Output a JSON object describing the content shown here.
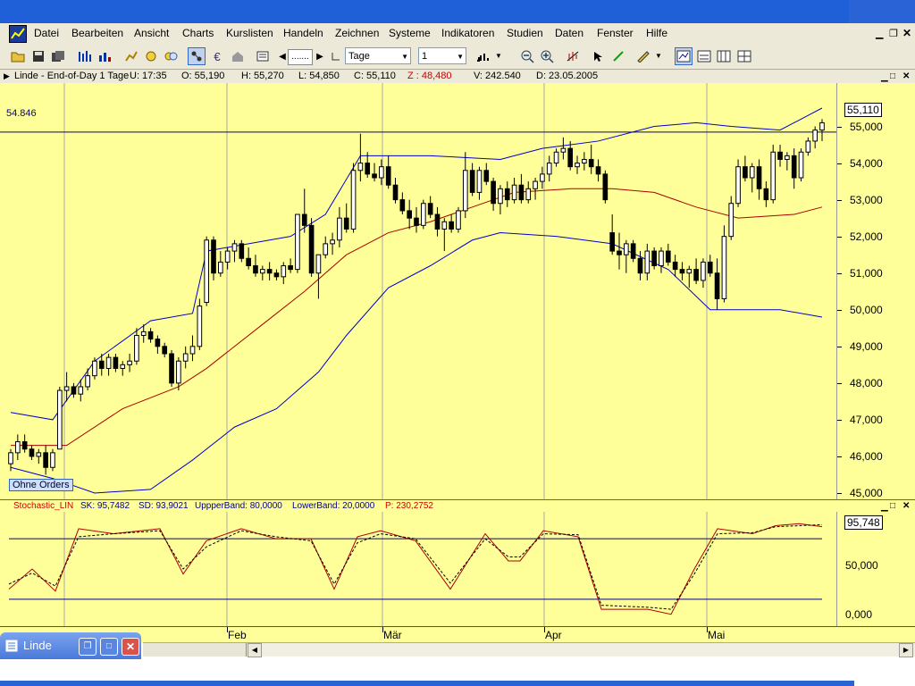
{
  "menu": {
    "items": [
      {
        "name": "datei",
        "label": "Datei"
      },
      {
        "name": "bearbeiten",
        "label": "Bearbeiten"
      },
      {
        "name": "ansicht",
        "label": "Ansicht"
      },
      {
        "name": "charts",
        "label": "Charts"
      },
      {
        "name": "kurslisten",
        "label": "Kurslisten"
      },
      {
        "name": "handeln",
        "label": "Handeln"
      },
      {
        "name": "zeichnen",
        "label": "Zeichnen"
      },
      {
        "name": "systeme",
        "label": "Systeme"
      },
      {
        "name": "indikatoren",
        "label": "Indikatoren"
      },
      {
        "name": "studien",
        "label": "Studien"
      },
      {
        "name": "daten",
        "label": "Daten"
      },
      {
        "name": "fenster",
        "label": "Fenster"
      },
      {
        "name": "hilfe",
        "label": "Hilfe"
      }
    ]
  },
  "toolbar": {
    "period_value": "Tage",
    "interval_value": "1"
  },
  "info": {
    "symbol": "Linde - End-of-Day 1 Tage",
    "u": "U: 17:35",
    "o": "O: 55,190",
    "h": "H: 55,270",
    "l": "L: 54,850",
    "c": "C: 55,110",
    "z": "Z : 48,480",
    "v": "V: 242.540",
    "d": "D: 23.05.2005"
  },
  "price_chart": {
    "line_label": "54.846",
    "last_price": "55,110",
    "orders_label": "Ohne Orders",
    "axis_ticks": [
      "55,000",
      "54,000",
      "53,000",
      "52,000",
      "51,000",
      "50,000",
      "49,000",
      "48,000",
      "47,000",
      "46,000",
      "45,000"
    ]
  },
  "stoch": {
    "title": "Stochastic_LIN",
    "sk": "SK: 95,7482",
    "sd": "SD: 93,9021",
    "upper": "UppperBand: 80,0000",
    "lower": "LowerBand: 20,0000",
    "p": "P: 230,2752",
    "last_value": "95,748",
    "axis_ticks": [
      "50,000",
      "0,000"
    ]
  },
  "dates": [
    "Feb",
    "Mär",
    "Apr",
    "Mai"
  ],
  "taskbar": {
    "window_label": "Linde"
  },
  "colors": {
    "chart_bg": "#ffff99",
    "bollinger": "#0000cc",
    "ma": "#aa0000",
    "candle_down": "#000000",
    "candle_up": "#ffffff"
  },
  "chart_data": {
    "type": "candlestick",
    "title": "Linde - End-of-Day 1 Tage",
    "ylim": [
      45.0,
      55.5
    ],
    "x_labels": [
      "Feb",
      "Mär",
      "Apr",
      "Mai"
    ],
    "candles": [
      [
        45.8,
        46.2,
        45.6,
        46.1
      ],
      [
        46.1,
        46.6,
        45.9,
        46.4
      ],
      [
        46.4,
        46.6,
        46.1,
        46.2
      ],
      [
        46.2,
        46.3,
        45.9,
        46.0
      ],
      [
        46.0,
        46.2,
        45.8,
        46.1
      ],
      [
        46.1,
        46.3,
        45.5,
        45.7
      ],
      [
        45.7,
        46.2,
        45.6,
        46.1
      ],
      [
        46.2,
        47.9,
        46.2,
        47.8
      ],
      [
        47.8,
        48.3,
        47.5,
        47.9
      ],
      [
        47.9,
        48.0,
        47.6,
        47.7
      ],
      [
        47.7,
        48.1,
        47.5,
        47.9
      ],
      [
        47.9,
        48.4,
        47.8,
        48.2
      ],
      [
        48.2,
        48.7,
        48.1,
        48.6
      ],
      [
        48.6,
        48.8,
        48.2,
        48.4
      ],
      [
        48.4,
        48.8,
        48.2,
        48.7
      ],
      [
        48.7,
        48.8,
        48.3,
        48.4
      ],
      [
        48.4,
        48.6,
        48.2,
        48.5
      ],
      [
        48.5,
        48.8,
        48.3,
        48.6
      ],
      [
        48.6,
        49.5,
        48.5,
        49.3
      ],
      [
        49.3,
        49.6,
        49.1,
        49.4
      ],
      [
        49.4,
        49.5,
        49.1,
        49.2
      ],
      [
        49.2,
        49.3,
        48.8,
        49.0
      ],
      [
        49.0,
        49.1,
        48.7,
        48.8
      ],
      [
        48.8,
        48.9,
        47.9,
        48.0
      ],
      [
        48.0,
        48.7,
        47.8,
        48.6
      ],
      [
        48.6,
        49.0,
        48.4,
        48.8
      ],
      [
        48.8,
        49.3,
        48.6,
        49.0
      ],
      [
        49.0,
        50.3,
        48.9,
        50.1
      ],
      [
        50.2,
        52.0,
        50.1,
        51.9
      ],
      [
        51.9,
        52.0,
        50.8,
        51.0
      ],
      [
        51.0,
        51.6,
        50.9,
        51.3
      ],
      [
        51.3,
        51.7,
        51.1,
        51.6
      ],
      [
        51.6,
        51.9,
        51.3,
        51.8
      ],
      [
        51.8,
        51.9,
        51.3,
        51.4
      ],
      [
        51.4,
        51.7,
        51.1,
        51.2
      ],
      [
        51.2,
        51.5,
        50.9,
        51.0
      ],
      [
        51.0,
        51.2,
        50.8,
        51.1
      ],
      [
        51.1,
        51.3,
        50.8,
        51.0
      ],
      [
        51.0,
        51.1,
        50.8,
        50.9
      ],
      [
        50.9,
        51.3,
        50.7,
        51.2
      ],
      [
        51.2,
        51.4,
        51.0,
        51.1
      ],
      [
        51.1,
        52.6,
        51.0,
        52.6
      ],
      [
        52.6,
        53.3,
        52.1,
        52.3
      ],
      [
        52.3,
        52.5,
        50.9,
        51.0
      ],
      [
        51.0,
        51.5,
        50.3,
        51.5
      ],
      [
        51.5,
        52.0,
        51.4,
        51.8
      ],
      [
        51.8,
        52.1,
        51.5,
        51.9
      ],
      [
        51.9,
        52.8,
        51.7,
        52.5
      ],
      [
        52.5,
        52.9,
        52.1,
        52.2
      ],
      [
        52.2,
        54.0,
        52.1,
        53.8
      ],
      [
        53.8,
        54.8,
        53.5,
        54.0
      ],
      [
        54.0,
        54.3,
        53.6,
        53.7
      ],
      [
        53.7,
        54.0,
        53.5,
        53.6
      ],
      [
        53.6,
        54.1,
        53.4,
        53.9
      ],
      [
        53.9,
        54.2,
        53.3,
        53.4
      ],
      [
        53.4,
        53.6,
        52.9,
        53.0
      ],
      [
        53.0,
        53.2,
        52.6,
        52.7
      ],
      [
        52.7,
        53.0,
        52.2,
        52.5
      ],
      [
        52.5,
        52.8,
        52.1,
        52.3
      ],
      [
        52.3,
        53.0,
        52.2,
        52.9
      ],
      [
        52.9,
        53.1,
        52.5,
        52.6
      ],
      [
        52.6,
        52.8,
        52.0,
        52.2
      ],
      [
        52.2,
        52.5,
        51.6,
        52.4
      ],
      [
        52.4,
        52.6,
        52.1,
        52.2
      ],
      [
        52.2,
        52.8,
        52.1,
        52.7
      ],
      [
        52.7,
        54.3,
        52.5,
        53.8
      ],
      [
        53.8,
        54.0,
        53.1,
        53.2
      ],
      [
        53.2,
        53.9,
        53.0,
        53.8
      ],
      [
        53.8,
        54.0,
        53.4,
        53.5
      ],
      [
        53.5,
        53.6,
        52.7,
        52.9
      ],
      [
        52.9,
        53.4,
        52.6,
        53.3
      ],
      [
        53.3,
        53.5,
        52.8,
        53.0
      ],
      [
        53.0,
        53.6,
        52.9,
        53.4
      ],
      [
        53.4,
        53.7,
        52.9,
        53.0
      ],
      [
        53.0,
        53.5,
        52.9,
        53.3
      ],
      [
        53.3,
        53.6,
        53.0,
        53.5
      ],
      [
        53.5,
        53.9,
        53.3,
        53.7
      ],
      [
        53.7,
        54.2,
        53.5,
        54.0
      ],
      [
        54.0,
        54.4,
        53.9,
        54.3
      ],
      [
        54.3,
        54.7,
        54.1,
        54.4
      ],
      [
        54.4,
        54.6,
        53.8,
        53.9
      ],
      [
        53.9,
        54.2,
        53.7,
        54.0
      ],
      [
        54.0,
        54.3,
        53.8,
        54.1
      ],
      [
        54.1,
        54.5,
        53.7,
        53.9
      ],
      [
        53.9,
        54.1,
        53.5,
        53.7
      ],
      [
        53.7,
        53.8,
        52.9,
        53.0
      ],
      [
        52.1,
        52.6,
        51.5,
        51.6
      ],
      [
        51.6,
        52.1,
        51.1,
        51.5
      ],
      [
        51.5,
        51.9,
        51.0,
        51.8
      ],
      [
        51.8,
        51.9,
        51.3,
        51.4
      ],
      [
        51.4,
        51.6,
        50.8,
        51.0
      ],
      [
        51.0,
        51.8,
        50.8,
        51.6
      ],
      [
        51.6,
        51.7,
        51.1,
        51.2
      ],
      [
        51.2,
        51.7,
        51.0,
        51.6
      ],
      [
        51.6,
        51.8,
        51.2,
        51.3
      ],
      [
        51.3,
        51.5,
        50.9,
        51.1
      ],
      [
        51.1,
        51.3,
        50.8,
        51.0
      ],
      [
        51.0,
        51.2,
        50.6,
        51.1
      ],
      [
        51.1,
        51.4,
        50.7,
        50.8
      ],
      [
        50.8,
        51.4,
        50.6,
        51.3
      ],
      [
        51.3,
        51.5,
        50.9,
        51.0
      ],
      [
        51.0,
        51.4,
        50.0,
        50.3
      ],
      [
        50.3,
        52.3,
        50.2,
        52.0
      ],
      [
        52.0,
        53.1,
        51.9,
        52.9
      ],
      [
        52.9,
        54.1,
        52.8,
        53.9
      ],
      [
        53.9,
        54.2,
        53.5,
        53.6
      ],
      [
        53.6,
        54.0,
        53.2,
        53.9
      ],
      [
        53.9,
        54.1,
        53.0,
        53.3
      ],
      [
        53.3,
        53.5,
        52.8,
        53.0
      ],
      [
        53.0,
        54.5,
        52.9,
        54.3
      ],
      [
        54.3,
        54.5,
        53.9,
        54.1
      ],
      [
        54.1,
        54.3,
        53.8,
        54.2
      ],
      [
        54.2,
        54.4,
        53.3,
        53.6
      ],
      [
        53.6,
        54.4,
        53.5,
        54.3
      ],
      [
        54.3,
        54.7,
        54.2,
        54.6
      ],
      [
        54.6,
        55.0,
        54.4,
        54.9
      ],
      [
        54.9,
        55.2,
        54.6,
        55.1
      ]
    ],
    "bollinger_upper_key": [
      [
        0,
        47.2
      ],
      [
        6,
        47.0
      ],
      [
        12,
        48.6
      ],
      [
        20,
        49.7
      ],
      [
        26,
        49.9
      ],
      [
        28,
        51.6
      ],
      [
        40,
        52.0
      ],
      [
        45,
        52.6
      ],
      [
        50,
        54.2
      ],
      [
        60,
        54.2
      ],
      [
        70,
        54.1
      ],
      [
        76,
        54.4
      ],
      [
        84,
        54.6
      ],
      [
        92,
        55.0
      ],
      [
        98,
        55.1
      ],
      [
        103,
        55.0
      ],
      [
        110,
        54.9
      ],
      [
        116,
        55.5
      ]
    ],
    "bollinger_lower_key": [
      [
        0,
        45.7
      ],
      [
        6,
        45.4
      ],
      [
        12,
        45.0
      ],
      [
        20,
        45.1
      ],
      [
        26,
        45.9
      ],
      [
        32,
        46.8
      ],
      [
        38,
        47.3
      ],
      [
        44,
        48.3
      ],
      [
        48,
        49.3
      ],
      [
        54,
        50.6
      ],
      [
        60,
        51.2
      ],
      [
        66,
        51.9
      ],
      [
        70,
        52.1
      ],
      [
        78,
        52.0
      ],
      [
        86,
        51.8
      ],
      [
        94,
        51.1
      ],
      [
        100,
        50.0
      ],
      [
        110,
        50.0
      ],
      [
        116,
        49.8
      ]
    ],
    "ma_key": [
      [
        0,
        46.3
      ],
      [
        8,
        46.3
      ],
      [
        16,
        47.3
      ],
      [
        24,
        47.9
      ],
      [
        28,
        48.4
      ],
      [
        36,
        49.6
      ],
      [
        42,
        50.5
      ],
      [
        48,
        51.5
      ],
      [
        54,
        52.1
      ],
      [
        60,
        52.4
      ],
      [
        66,
        52.8
      ],
      [
        72,
        53.2
      ],
      [
        80,
        53.3
      ],
      [
        86,
        53.3
      ],
      [
        92,
        53.2
      ],
      [
        98,
        52.8
      ],
      [
        104,
        52.5
      ],
      [
        112,
        52.6
      ],
      [
        116,
        52.8
      ]
    ],
    "stoch_sk_key": [
      [
        0,
        30
      ],
      [
        4,
        50
      ],
      [
        8,
        28
      ],
      [
        12,
        90
      ],
      [
        18,
        85
      ],
      [
        26,
        90
      ],
      [
        30,
        45
      ],
      [
        34,
        78
      ],
      [
        40,
        90
      ],
      [
        46,
        80
      ],
      [
        52,
        80
      ],
      [
        56,
        30
      ],
      [
        60,
        82
      ],
      [
        64,
        88
      ],
      [
        70,
        78
      ],
      [
        76,
        30
      ],
      [
        82,
        85
      ],
      [
        86,
        58
      ],
      [
        88,
        58
      ],
      [
        92,
        88
      ],
      [
        98,
        82
      ],
      [
        102,
        10
      ],
      [
        110,
        10
      ],
      [
        114,
        5
      ],
      [
        118,
        50
      ],
      [
        122,
        90
      ],
      [
        128,
        85
      ],
      [
        132,
        93
      ],
      [
        136,
        95
      ],
      [
        140,
        92
      ]
    ],
    "stoch_sd_key": [
      [
        0,
        35
      ],
      [
        4,
        46
      ],
      [
        8,
        33
      ],
      [
        12,
        82
      ],
      [
        18,
        85
      ],
      [
        26,
        88
      ],
      [
        30,
        50
      ],
      [
        34,
        72
      ],
      [
        40,
        88
      ],
      [
        46,
        82
      ],
      [
        52,
        78
      ],
      [
        56,
        35
      ],
      [
        60,
        76
      ],
      [
        64,
        85
      ],
      [
        70,
        80
      ],
      [
        76,
        36
      ],
      [
        82,
        80
      ],
      [
        86,
        62
      ],
      [
        88,
        62
      ],
      [
        92,
        85
      ],
      [
        98,
        84
      ],
      [
        102,
        14
      ],
      [
        110,
        12
      ],
      [
        114,
        10
      ],
      [
        118,
        45
      ],
      [
        122,
        85
      ],
      [
        128,
        86
      ],
      [
        132,
        92
      ],
      [
        136,
        93
      ],
      [
        140,
        94
      ]
    ],
    "stoch_upper_band": 80,
    "stoch_lower_band": 20,
    "stoch_ylim": [
      -5,
      105
    ],
    "last_close": 55.11,
    "horizontal_line": 54.846
  }
}
